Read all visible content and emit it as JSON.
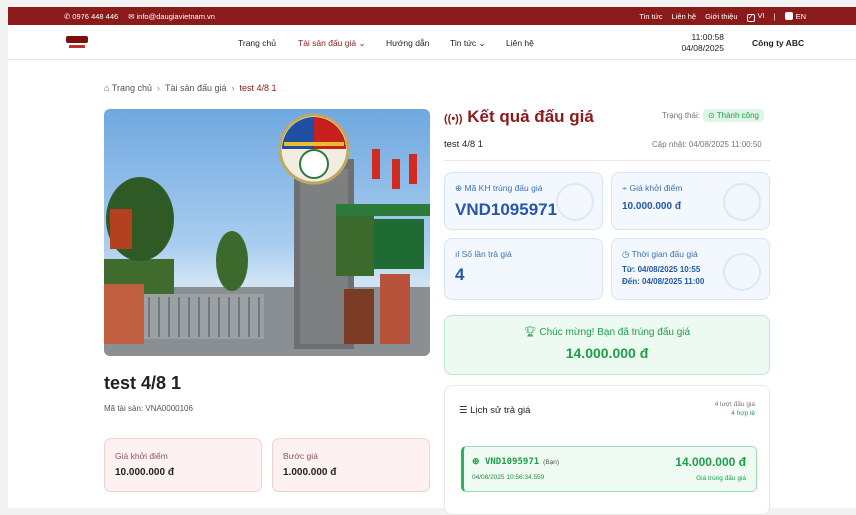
{
  "topbar": {
    "phone": "0976 448 446",
    "email": "info@daugiavietnam.vn",
    "links": [
      "Tin tức",
      "Liên hệ",
      "Giới thiệu"
    ],
    "lang_vi": "VI",
    "lang_en": "EN"
  },
  "nav": {
    "items": [
      "Trang chủ",
      "Tài sản đấu giá ⌄",
      "Hướng dẫn",
      "Tin tức ⌄",
      "Liên hệ"
    ],
    "time": "11:00:58",
    "date": "04/08/2025",
    "company": "Công ty ABC",
    "accent": "#8b1a1a"
  },
  "breadcrumb": [
    "Trang chủ",
    "Tài sản đấu giá",
    "test 4/8 1"
  ],
  "asset": {
    "title": "test 4/8 1",
    "code": "Mã tài sản: VNA0000106",
    "cards": [
      {
        "label": "Giá khởi điểm",
        "value": "10.000.000 đ"
      },
      {
        "label": "Bước giá",
        "value": "1.000.000 đ"
      }
    ]
  },
  "result": {
    "title": "Kết quả đấu giá",
    "status_label": "Trạng thái:",
    "status_value": "Thành công",
    "subtitle": "test 4/8 1",
    "updated": "Cập nhật: 04/08/2025 11:00:50",
    "winner_label": "Mã KH trúng đấu giá",
    "winner_value": "VND1095971",
    "start_label": "Giá khởi điểm",
    "start_value": "10.000.000 đ",
    "bids_label": "Số lần trả giá",
    "bids_value": "4",
    "time_label": "Thời gian đấu giá",
    "time_from": "Từ: 04/08/2025 10:55",
    "time_to": "Đến: 04/08/2025 11:00",
    "congrats": "Chúc mừng! Bạn đã trúng đấu giá",
    "win_amount": "14.000.000 đ"
  },
  "history": {
    "title": "Lịch sử trả giá",
    "count": "4 lượt đấu giá",
    "valid": "4 hợp lệ",
    "rows": [
      {
        "code": "VND1095971",
        "you": "(Bạn)",
        "time": "04/08/2025 10:56:34.559",
        "amount": "14.000.000 đ",
        "tag": "Giá trúng đấu giá"
      }
    ]
  }
}
